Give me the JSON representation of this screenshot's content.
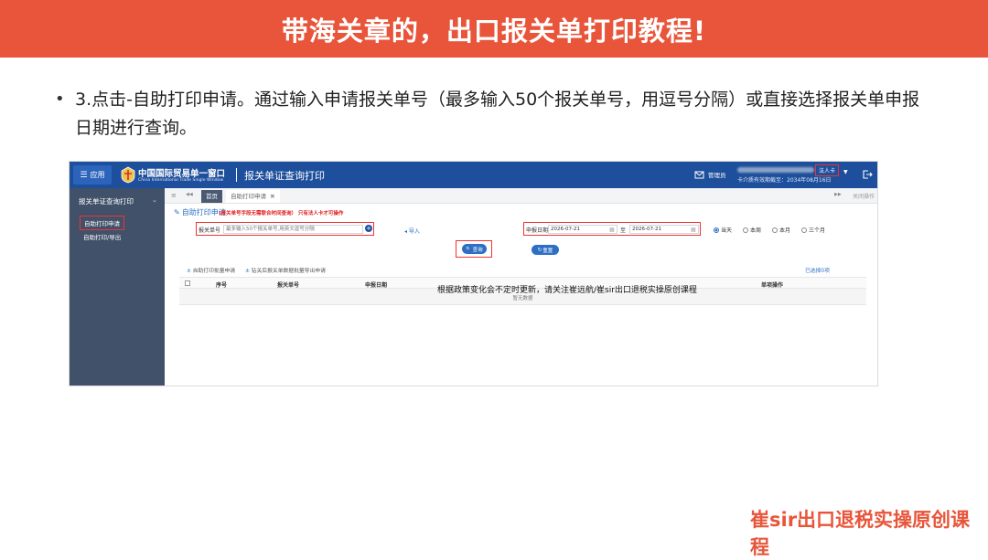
{
  "slide": {
    "title": "带海关章的，出口报关单打印教程!",
    "bullet": "•",
    "step_text": "3.点击-自助打印申请。通过输入申请报关单号（最多输入50个报关单号，用逗号分隔）或直接选择报关单申报日期进行查询。",
    "watermark": "崔sir出口退税实操原创课程",
    "overlay_note": "根据政策变化会不定时更新，请关注崔远航/崔sir出口退税实操原创课程"
  },
  "topbar": {
    "app_glyph": "☰",
    "app_label": "应用",
    "logo_cn": "中国国际贸易单一窗口",
    "logo_en": "China International Trade Single Window",
    "module_title": "报关单证查询打印",
    "admin_label": "管理员",
    "role_badge": "法人卡",
    "role_caret": "▼",
    "expire_text": "卡介质有效期截至：2034年08月16日"
  },
  "sidebar": {
    "header": "报关单证查询打印",
    "header_caret": "⌄",
    "items": [
      {
        "label": "自助打印申请",
        "active": true
      },
      {
        "label": "自助打印/导出",
        "active": false
      }
    ]
  },
  "tabs": {
    "menu_glyph": "≡",
    "prev_glyph": "◀◀",
    "home": "首页",
    "current": "自助打印申请",
    "close_glyph": "✖",
    "next_glyph": "▶▶",
    "close_all": "关闭操作"
  },
  "panel": {
    "edit_glyph": "✎",
    "title": "自助打印申请",
    "note": "(报关单号字段无需联合时间查询）  只有法人卡才可操作"
  },
  "form": {
    "decl_no_label": "报关单号",
    "decl_no_placeholder": "最多输入50个报关单号,用英文逗号分隔",
    "add_glyph": "+",
    "import_label": "导入",
    "date_label": "申报日期",
    "date_from": "2026-07-21",
    "date_to_label": "至",
    "date_to": "2026-07-21",
    "cal_glyph": "▦",
    "ranges": [
      {
        "label": "当天",
        "checked": true
      },
      {
        "label": "本周",
        "checked": false
      },
      {
        "label": "本月",
        "checked": false
      },
      {
        "label": "三个月",
        "checked": false
      }
    ],
    "query_label": "查询",
    "query_glyph": "🔍",
    "reset_label": "重置",
    "reset_glyph": "↻"
  },
  "table": {
    "batch_apply": "自助打印批量申请",
    "batch_export": "钻关后报关单数据批量导出申请",
    "plus_glyph": "±",
    "selected": "已选择0项",
    "headers": [
      "序号",
      "报关单号",
      "申报日期",
      "单项操作"
    ],
    "empty": "暂无数据"
  },
  "colors": {
    "banner": "#e8553a",
    "topbar": "#1d4f9c",
    "sidebar": "#41516a",
    "highlight_box": "#e33333",
    "accent": "#2d6fc4"
  }
}
